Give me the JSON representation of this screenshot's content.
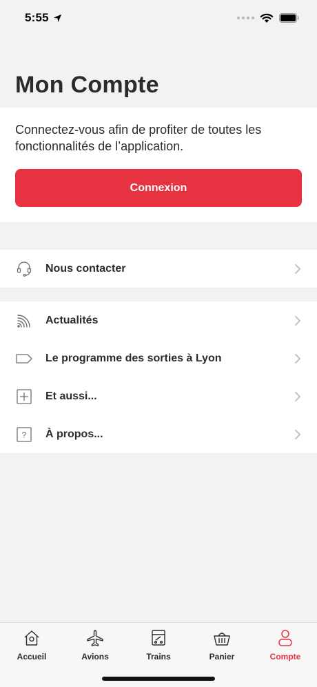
{
  "status_bar": {
    "time": "5:55"
  },
  "header": {
    "title": "Mon Compte"
  },
  "login": {
    "description": "Connectez-vous afin de profiter de toutes les fonctionnalités de l’application.",
    "button_label": "Connexion"
  },
  "menu_primary": [
    {
      "icon": "headset-icon",
      "label": "Nous contacter"
    }
  ],
  "menu_secondary": [
    {
      "icon": "rss-icon",
      "label": "Actualités"
    },
    {
      "icon": "tag-icon",
      "label": "Le programme des sorties à Lyon"
    },
    {
      "icon": "plus-box-icon",
      "label": "Et aussi..."
    },
    {
      "icon": "question-box-icon",
      "label": "À propos..."
    }
  ],
  "tab_bar": {
    "tabs": [
      {
        "icon": "house-icon",
        "label": "Accueil"
      },
      {
        "icon": "plane-icon",
        "label": "Avions"
      },
      {
        "icon": "train-icon",
        "label": "Trains"
      },
      {
        "icon": "basket-icon",
        "label": "Panier"
      },
      {
        "icon": "user-icon",
        "label": "Compte"
      }
    ],
    "active_tab": "Compte"
  },
  "colors": {
    "accent": "#e63241",
    "background": "#f2f2f4",
    "text": "#2c2c2e"
  }
}
